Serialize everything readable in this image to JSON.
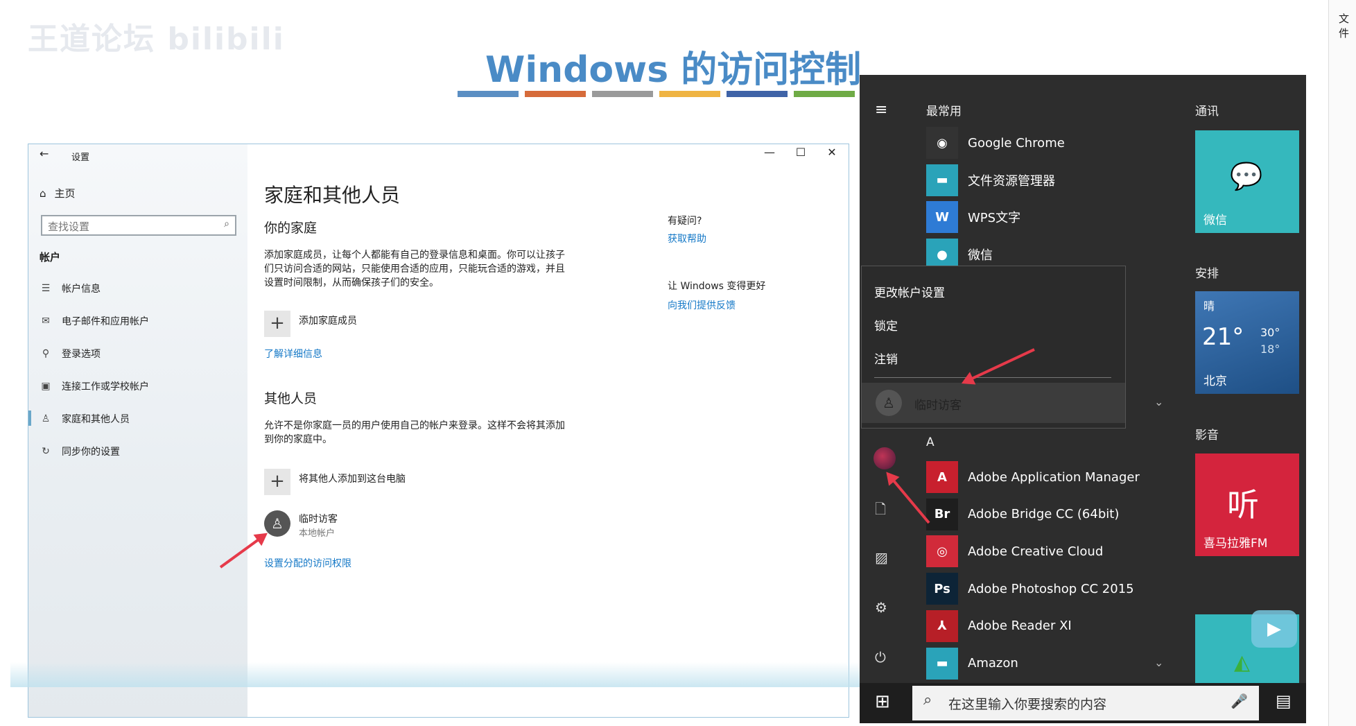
{
  "slide": {
    "watermark": "王道论坛 bilibili",
    "title": "Windows 的访问控制",
    "bar_colors": [
      "#5b8fc3",
      "#d66b3a",
      "#9a9a9a",
      "#efb443",
      "#3f63a7",
      "#6fab46"
    ]
  },
  "settings": {
    "window_title": "设置",
    "home": "主页",
    "search_placeholder": "查找设置",
    "section": "帐户",
    "nav": [
      {
        "icon": "user-card-icon",
        "label": "帐户信息"
      },
      {
        "icon": "mail-icon",
        "label": "电子邮件和应用帐户"
      },
      {
        "icon": "key-icon",
        "label": "登录选项"
      },
      {
        "icon": "briefcase-icon",
        "label": "连接工作或学校帐户"
      },
      {
        "icon": "person-icon",
        "label": "家庭和其他人员"
      },
      {
        "icon": "sync-icon",
        "label": "同步你的设置"
      }
    ],
    "page_title": "家庭和其他人员",
    "family_heading": "你的家庭",
    "family_desc": "添加家庭成员，让每个人都能有自己的登录信息和桌面。你可以让孩子们只访问合适的网站，只能使用合适的应用，只能玩合适的游戏，并且设置时间限制，从而确保孩子们的安全。",
    "add_family": "添加家庭成员",
    "learn_more": "了解详细信息",
    "others_heading": "其他人员",
    "others_desc": "允许不是你家庭一员的用户使用自己的帐户来登录。这样不会将其添加到你的家庭中。",
    "add_other": "将其他人添加到这台电脑",
    "guest_name": "临时访客",
    "guest_type": "本地帐户",
    "assigned_access": "设置分配的访问权限",
    "help_q": "有疑问?",
    "help_link": "获取帮助",
    "improve": "让 Windows 变得更好",
    "feedback": "向我们提供反馈"
  },
  "start": {
    "most_used": "最常用",
    "apps_top": [
      {
        "name": "Google Chrome",
        "icon": "chrome-icon",
        "glyph": "◉",
        "bg": "#333333"
      },
      {
        "name": "文件资源管理器",
        "icon": "folder-icon",
        "glyph": "▬",
        "bg": "#2aa3b9"
      },
      {
        "name": "WPS文字",
        "icon": "wps-icon",
        "glyph": "W",
        "bg": "#2e7bd5"
      },
      {
        "name": "微信",
        "icon": "wechat-icon",
        "glyph": "●",
        "bg": "#2aa3b9"
      }
    ],
    "account_menu": [
      "更改帐户设置",
      "锁定",
      "注销"
    ],
    "guest": "临时访客",
    "letter_a": "A",
    "apps_a": [
      {
        "name": "Adobe Application Manager",
        "icon": "adobe-icon",
        "glyph": "A",
        "bg": "#c8202e"
      },
      {
        "name": "Adobe Bridge CC (64bit)",
        "icon": "bridge-icon",
        "glyph": "Br",
        "bg": "#1e1e1e"
      },
      {
        "name": "Adobe Creative Cloud",
        "icon": "creative-cloud-icon",
        "glyph": "◎",
        "bg": "#d12a3a"
      },
      {
        "name": "Adobe Photoshop CC 2015",
        "icon": "photoshop-icon",
        "glyph": "Ps",
        "bg": "#0d2437"
      },
      {
        "name": "Adobe Reader XI",
        "icon": "reader-icon",
        "glyph": "⅄",
        "bg": "#b71f27"
      },
      {
        "name": "Amazon",
        "icon": "folder-icon",
        "glyph": "▬",
        "bg": "#2aa3b9"
      }
    ],
    "groups": {
      "tongxun": "通讯",
      "anpai": "安排",
      "yingyin": "影音"
    },
    "tiles": {
      "wechat": "微信",
      "weather_cond": "晴",
      "weather_temp": "21°",
      "weather_high": "30°",
      "weather_low": "18°",
      "weather_city": "北京",
      "ximalaya": "喜马拉雅FM",
      "ximalaya_glyph": "听"
    },
    "search_placeholder": "在这里输入你要搜索的内容"
  },
  "side": {
    "tag": "文件"
  }
}
